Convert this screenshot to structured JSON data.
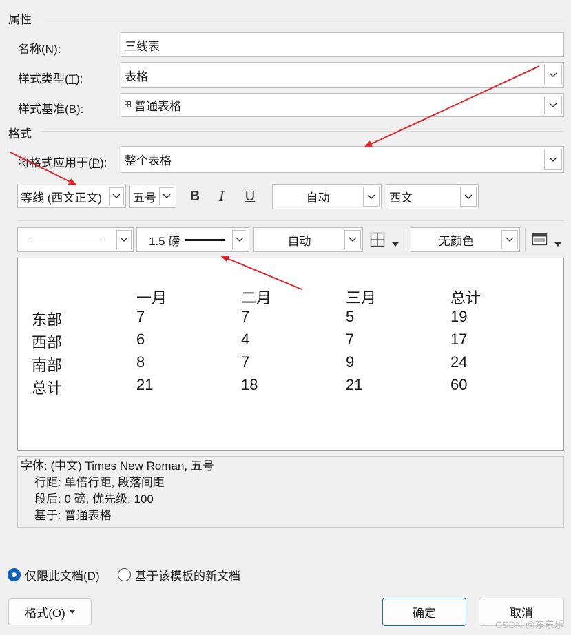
{
  "properties": {
    "section_title": "属性",
    "name_label": "名称(",
    "name_key": "N",
    "name_label_end": "):",
    "name_value": "三线表",
    "type_label": "样式类型(",
    "type_key": "T",
    "type_label_end": "):",
    "type_value": "表格",
    "based_label": "样式基准(",
    "based_key": "B",
    "based_label_end": "):",
    "based_value": "普通表格"
  },
  "format": {
    "section_title": "格式",
    "apply_label": "将格式应用于(",
    "apply_key": "P",
    "apply_label_end": "):",
    "apply_value": "整个表格",
    "font_value": "等线 (西文正文)",
    "size_value": "五号",
    "bold_label": "B",
    "italic_label": "I",
    "underline_label": "U",
    "color_value": "自动",
    "script_value": "西文",
    "border_weight": "1.5 磅",
    "border_color": "自动",
    "shading_value": "无颜色"
  },
  "preview_table": {
    "headers": [
      "一月",
      "二月",
      "三月",
      "总计"
    ],
    "rows": [
      {
        "label": "东部",
        "values": [
          "7",
          "7",
          "5",
          "19"
        ]
      },
      {
        "label": "西部",
        "values": [
          "6",
          "4",
          "7",
          "17"
        ]
      },
      {
        "label": "南部",
        "values": [
          "8",
          "7",
          "9",
          "24"
        ]
      },
      {
        "label": "总计",
        "values": [
          "21",
          "18",
          "21",
          "60"
        ]
      }
    ]
  },
  "description": {
    "line1": "字体: (中文) Times New Roman, 五号",
    "line2": "行距: 单倍行距, 段落间距",
    "line3": "段后: 0 磅, 优先级: 100",
    "line4": "基于: 普通表格"
  },
  "options": {
    "this_doc_label": "仅限此文档(D)",
    "template_label": "基于该模板的新文档"
  },
  "buttons": {
    "format_label": "格式(O)",
    "ok_label": "确定",
    "cancel_label": "取消"
  },
  "watermark": "CSDN @东东乐",
  "colors": {
    "arrow": "#e0262b",
    "accent": "#0a5fbf"
  },
  "icons": [
    "chevron-down-icon",
    "table-grid-icon",
    "border-icon",
    "shading-icon",
    "borders-dropdown-icon",
    "radio-checked-icon"
  ]
}
